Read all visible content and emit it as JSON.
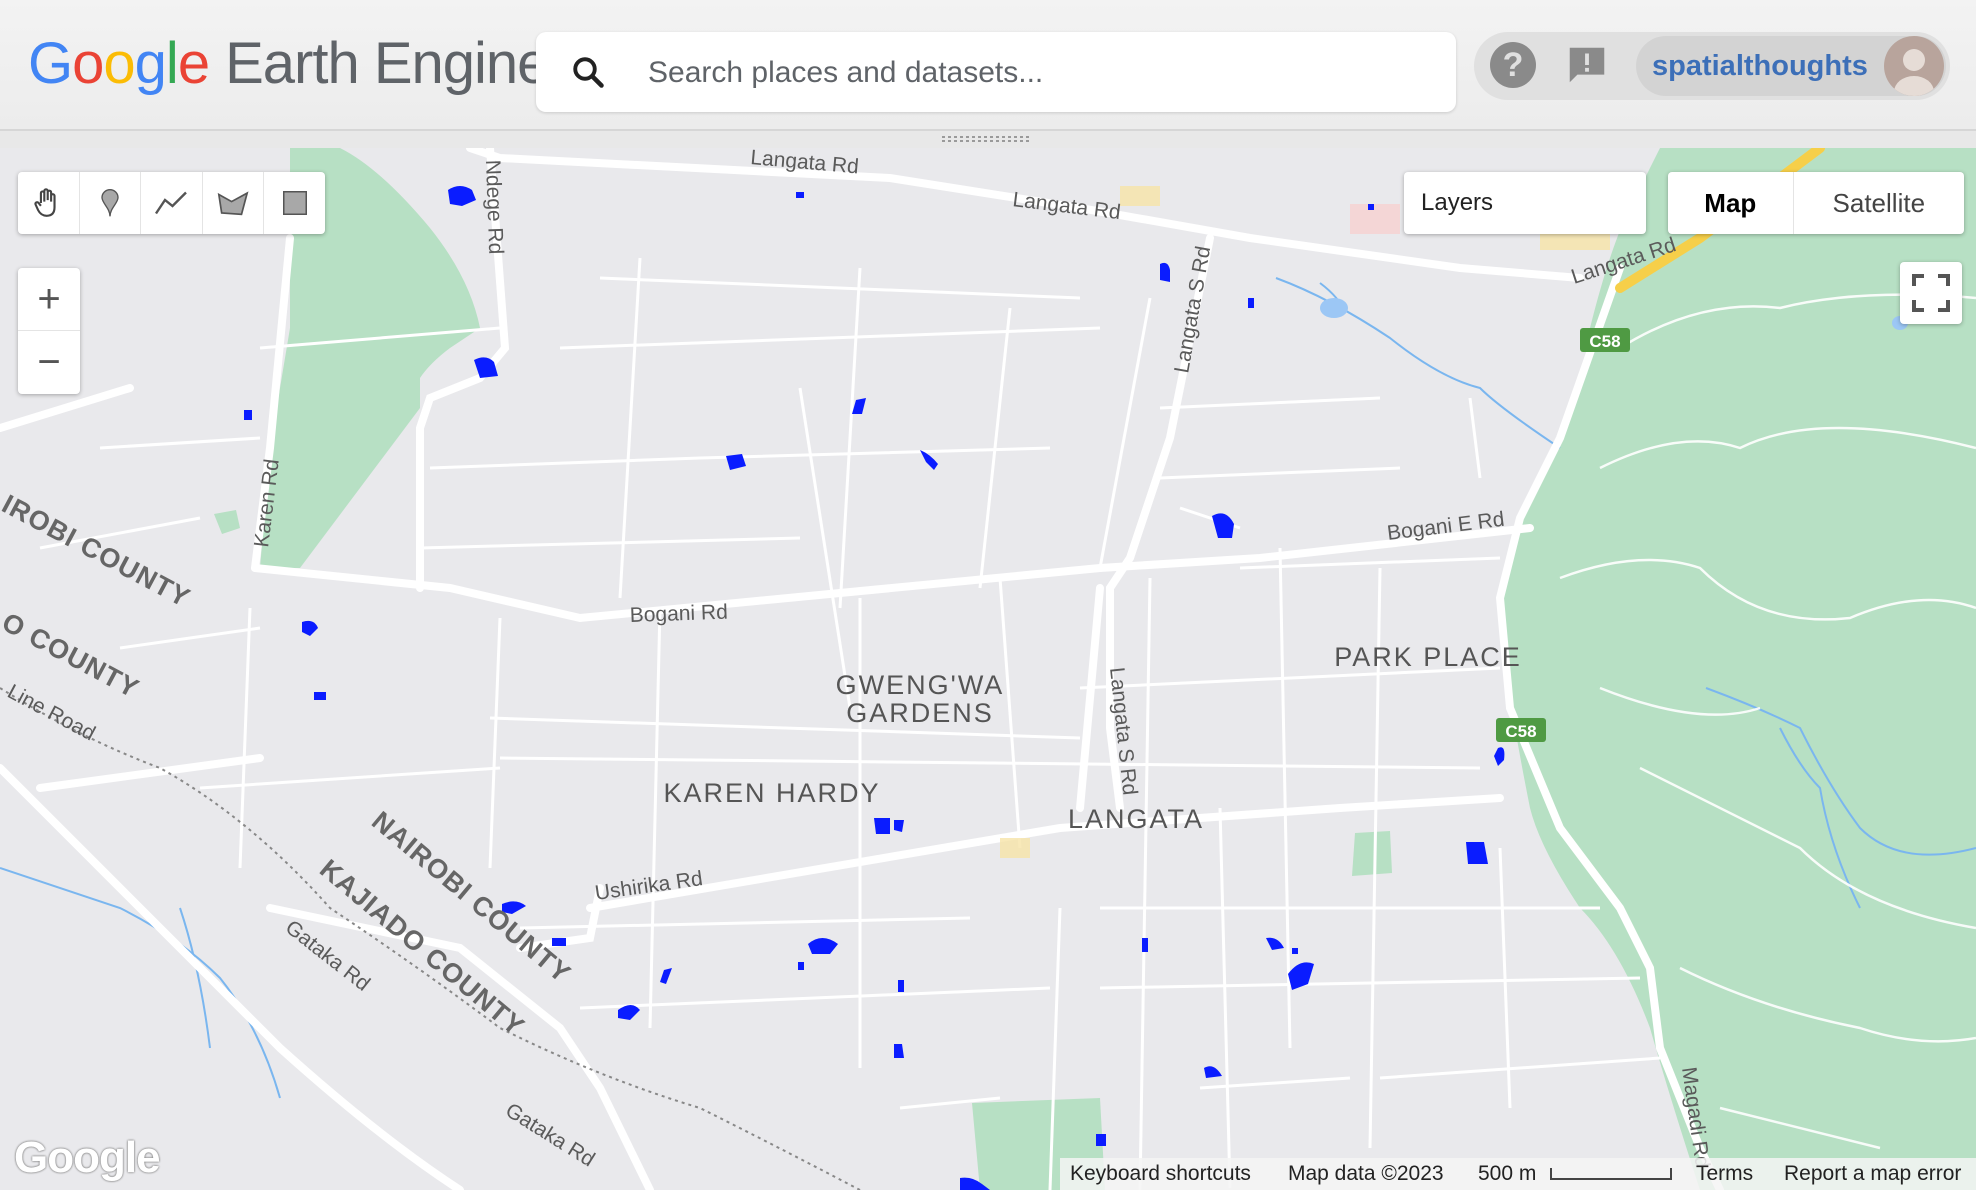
{
  "header": {
    "logo_google": "Google",
    "logo_earth_engine": "Earth Engine",
    "search_placeholder": "Search places and datasets...",
    "help_label": "?",
    "username": "spatialthoughts"
  },
  "drawing_tools": [
    "hand-tool",
    "marker-tool",
    "line-tool",
    "polygon-tool",
    "rectangle-tool"
  ],
  "zoom": {
    "in": "+",
    "out": "−"
  },
  "layers_button": "Layers",
  "map_type": {
    "map": "Map",
    "satellite": "Satellite",
    "selected": "Map"
  },
  "map_labels": {
    "roads": {
      "langata_rd_1": "Langata Rd",
      "langata_rd_2": "Langata Rd",
      "langata_rd_3": "Langata Rd",
      "ndege_rd": "Ndege Rd",
      "karen_rd": "Karen Rd",
      "langata_s_rd_1": "Langata S Rd",
      "langata_s_rd_2": "Langata S Rd",
      "bogani_rd": "Bogani Rd",
      "bogani_e_rd": "Bogani E Rd",
      "ushirika_rd": "Ushirika Rd",
      "gataka_rd_1": "Gataka Rd",
      "gataka_rd_2": "Gataka Rd",
      "magadi_rd": "Magadi Rd",
      "line_road": "Line Road",
      "c58_1": "C58",
      "c58_2": "C58"
    },
    "areas": {
      "gwengwa_1": "GWENG'WA",
      "gwengwa_2": "GARDENS",
      "karen_hardy": "KAREN HARDY",
      "langata": "LANGATA",
      "park_place": "PARK PLACE"
    },
    "counties": {
      "nairobi_1": "IROBI COUNTY",
      "nairobi_2": "NAIROBI COUNTY",
      "kajiado_1": "O COUNTY",
      "kajiado_2": "KAJIADO COUNTY"
    }
  },
  "attribution": {
    "google_logo": "Google",
    "keyboard_shortcuts": "Keyboard shortcuts",
    "map_data": "Map data ©2023",
    "scale": "500 m",
    "terms": "Terms",
    "report": "Report a map error"
  },
  "colors": {
    "water_detection": "#0a1cff",
    "park_green": "#b7e0c4",
    "map_background": "#e9e9ec",
    "road": "#ffffff",
    "highway": "#f6cf49"
  }
}
